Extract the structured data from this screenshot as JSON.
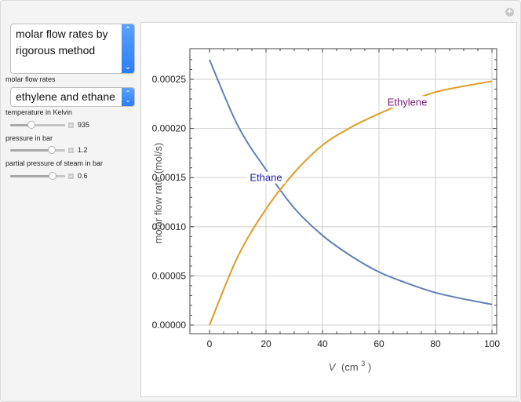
{
  "controls": {
    "plot_type": {
      "options_visible": [
        "molar flow rates by rigorous method"
      ],
      "selected": "molar flow rates by rigorous method"
    },
    "molar_flow_rates": {
      "label": "molar flow rates",
      "selected": "ethylene and ethane"
    },
    "sliders": [
      {
        "label": "temperature in Kelvin",
        "value": "935",
        "fraction": 0.38
      },
      {
        "label": "pressure in bar",
        "value": "1.2",
        "fraction": 0.75
      },
      {
        "label": "partial pressure of steam in bar",
        "value": "0.6",
        "fraction": 0.77
      }
    ],
    "icons": {
      "increment": "plus-icon",
      "corner": "plus-circle-icon",
      "scroll_up": "chevron-up-icon",
      "scroll_down": "chevron-down-icon"
    }
  },
  "chart_data": {
    "type": "line",
    "title": "",
    "xlabel": "V",
    "xlabel_unit": "(cm",
    "xlabel_sup": "3",
    "xlabel_close": ")",
    "ylabel": "molar flow rate (mol/s)",
    "xlim": [
      0,
      100
    ],
    "ylim": [
      0,
      0.00027
    ],
    "xticks": [
      0,
      20,
      40,
      60,
      80,
      100
    ],
    "xtick_labels": [
      "0",
      "20",
      "40",
      "60",
      "80",
      "100"
    ],
    "yticks": [
      0,
      5e-05,
      0.0001,
      0.00015,
      0.0002,
      0.00025
    ],
    "ytick_labels": [
      "0.00000",
      "0.00005",
      "0.00010",
      "0.00015",
      "0.00020",
      "0.00025"
    ],
    "grid": true,
    "x": [
      0,
      10,
      20,
      30,
      40,
      50,
      60,
      70,
      80,
      90,
      100
    ],
    "series": [
      {
        "name": "Ethane",
        "color": "#5e81b5",
        "label_color": "#1a1aa8",
        "label_at": [
          20,
          0.000148
        ],
        "values": [
          0.00027,
          0.000203,
          0.000158,
          0.000119,
          9.12e-05,
          7.05e-05,
          5.4e-05,
          4.25e-05,
          3.3e-05,
          2.65e-05,
          2.1e-05
        ]
      },
      {
        "name": "Ethylene",
        "color": "#e19c24",
        "label_color": "#7a1a7a",
        "label_at": [
          70,
          0.000225
        ],
        "values": [
          0.0,
          6.95e-05,
          0.000118,
          0.000155,
          0.000183,
          0.000201,
          0.000215,
          0.000227,
          0.000237,
          0.000243,
          0.000248
        ]
      }
    ]
  }
}
